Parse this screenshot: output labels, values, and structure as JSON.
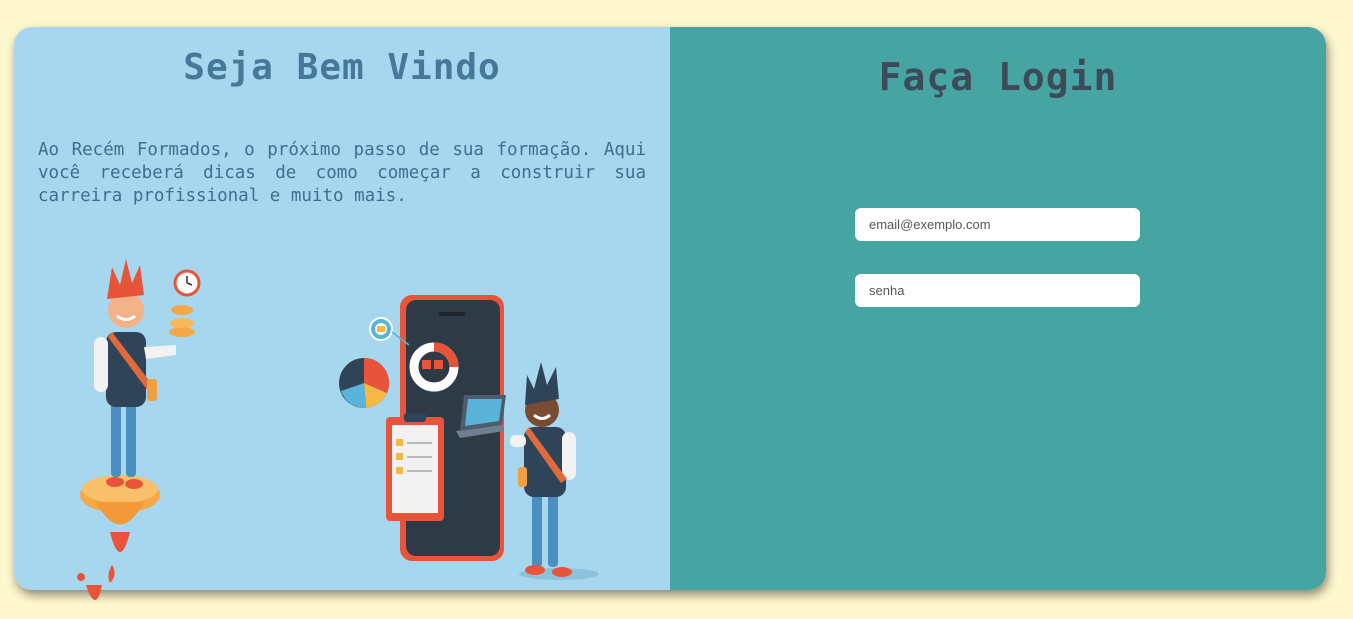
{
  "welcome": {
    "title": "Seja Bem Vindo",
    "text": "Ao Recém Formados, o próximo passo de sua formação. Aqui você receberá dicas de como começar a construir sua carreira profissional e muito mais."
  },
  "login": {
    "title": "Faça Login",
    "email_placeholder": "email@exemplo.com",
    "password_placeholder": "senha"
  },
  "colors": {
    "page_background": "#fff8cf",
    "left_panel": "#a7d7ee",
    "right_panel": "#46a5a3"
  },
  "icons": [
    "person-on-rocket-illustration",
    "smartphone-illustration",
    "pie-chart-icon",
    "clipboard-checklist-icon",
    "person-with-laptop-illustration",
    "clock-icon",
    "coins-icon"
  ]
}
